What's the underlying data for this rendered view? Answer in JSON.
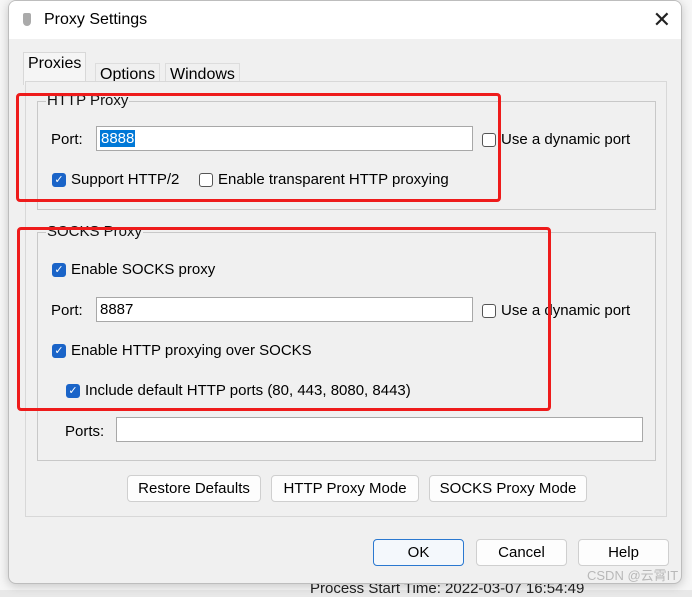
{
  "window": {
    "title": "Proxy Settings",
    "close_icon": "close-icon"
  },
  "tabs": [
    {
      "label": "Proxies",
      "active": true
    },
    {
      "label": "Options"
    },
    {
      "label": "Windows"
    }
  ],
  "http_proxy": {
    "group_label": "HTTP Proxy",
    "port_label": "Port:",
    "port_value": "8888",
    "dynamic_port_label": "Use a dynamic port",
    "dynamic_port_checked": false,
    "http2_label": "Support HTTP/2",
    "http2_checked": true,
    "transparent_label": "Enable transparent HTTP proxying",
    "transparent_checked": false
  },
  "socks_proxy": {
    "group_label": "SOCKS Proxy",
    "enable_label": "Enable SOCKS proxy",
    "enable_checked": true,
    "port_label": "Port:",
    "port_value": "8887",
    "dynamic_port_label": "Use a dynamic port",
    "dynamic_port_checked": false,
    "http_over_socks_label": "Enable HTTP proxying over SOCKS",
    "http_over_socks_checked": true,
    "default_ports_label": "Include default HTTP ports (80, 443, 8080, 8443)",
    "default_ports_checked": true,
    "ports_label": "Ports:",
    "ports_value": ""
  },
  "mode_buttons": {
    "restore": "Restore Defaults",
    "http_mode": "HTTP Proxy Mode",
    "socks_mode": "SOCKS Proxy Mode"
  },
  "footer": {
    "ok": "OK",
    "cancel": "Cancel",
    "help": "Help"
  },
  "background": {
    "text": "Process Start Time: 2022-03-07 16:54:49"
  },
  "watermark": "CSDN @云霄IT",
  "highlight_color": "#ee1b1b"
}
